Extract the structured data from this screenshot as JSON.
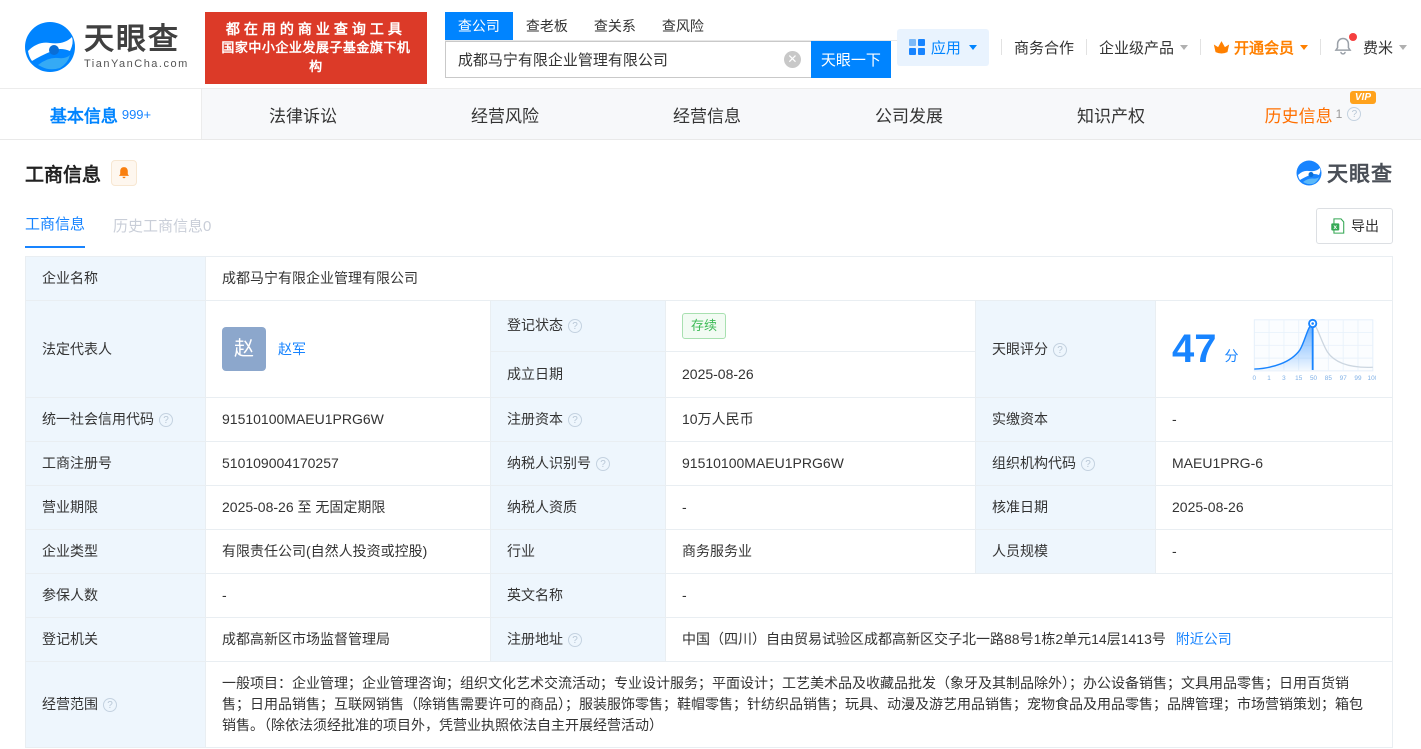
{
  "header": {
    "logo": {
      "title": "天眼查",
      "subtitle": "TianYanCha.com"
    },
    "slogan": {
      "line1": "都在用的商业查询工具",
      "line2": "国家中小企业发展子基金旗下机构"
    },
    "search": {
      "tabs": [
        {
          "label": "查公司"
        },
        {
          "label": "查老板"
        },
        {
          "label": "查关系"
        },
        {
          "label": "查风险"
        }
      ],
      "value": "成都马宁有限企业管理有限公司",
      "button": "天眼一下"
    },
    "menu": {
      "apps": "应用",
      "cooperation": "商务合作",
      "enterprise": "企业级产品",
      "vip": "开通会员",
      "username": "费米"
    }
  },
  "icons": {
    "clear": "circle-x",
    "apps": "grid",
    "vip": "crown",
    "notification": "bell",
    "monitor": "bell",
    "export": "excel",
    "help": "question-circle"
  },
  "nav_tabs": [
    {
      "label": "基本信息",
      "count": "999+"
    },
    {
      "label": "法律诉讼"
    },
    {
      "label": "经营风险"
    },
    {
      "label": "经营信息"
    },
    {
      "label": "公司发展"
    },
    {
      "label": "知识产权"
    },
    {
      "label": "历史信息",
      "badge": "VIP",
      "count": "1"
    }
  ],
  "section": {
    "title": "工商信息",
    "watermark": "天眼查",
    "subtabs": {
      "current": "工商信息",
      "history": "历史工商信息0"
    },
    "export_label": "导出"
  },
  "table": {
    "company_name": {
      "label": "企业名称",
      "value": "成都马宁有限企业管理有限公司"
    },
    "legal_rep": {
      "label": "法定代表人",
      "avatar": "赵",
      "name": "赵军"
    },
    "reg_status": {
      "label": "登记状态",
      "value": "存续"
    },
    "establish_date": {
      "label": "成立日期",
      "value": "2025-08-26"
    },
    "score": {
      "label": "天眼评分",
      "value": "47",
      "unit": "分",
      "axis_ticks": [
        "0",
        "1",
        "3",
        "15",
        "50",
        "85",
        "97",
        "99",
        "100"
      ]
    },
    "credit_code": {
      "label": "统一社会信用代码",
      "value": "91510100MAEU1PRG6W"
    },
    "reg_capital": {
      "label": "注册资本",
      "value": "10万人民币"
    },
    "paid_capital": {
      "label": "实缴资本",
      "value": "-"
    },
    "reg_number": {
      "label": "工商注册号",
      "value": "510109004170257"
    },
    "taxpayer_id": {
      "label": "纳税人识别号",
      "value": "91510100MAEU1PRG6W"
    },
    "org_code": {
      "label": "组织机构代码",
      "value": "MAEU1PRG-6"
    },
    "business_term": {
      "label": "营业期限",
      "value": "2025-08-26 至 无固定期限"
    },
    "taxpayer_quality": {
      "label": "纳税人资质",
      "value": "-"
    },
    "approval_date": {
      "label": "核准日期",
      "value": "2025-08-26"
    },
    "company_type": {
      "label": "企业类型",
      "value": "有限责任公司(自然人投资或控股)"
    },
    "industry": {
      "label": "行业",
      "value": "商务服务业"
    },
    "staff_size": {
      "label": "人员规模",
      "value": "-"
    },
    "insured_count": {
      "label": "参保人数",
      "value": "-"
    },
    "english_name": {
      "label": "英文名称",
      "value": "-"
    },
    "reg_authority": {
      "label": "登记机关",
      "value": "成都高新区市场监督管理局"
    },
    "reg_address": {
      "label": "注册地址",
      "value": "中国（四川）自由贸易试验区成都高新区交子北一路88号1栋2单元14层1413号",
      "link": "附近公司"
    },
    "business_scope": {
      "label": "经营范围",
      "value": "一般项目：企业管理；企业管理咨询；组织文化艺术交流活动；专业设计服务；平面设计；工艺美术品及收藏品批发（象牙及其制品除外）；办公设备销售；文具用品零售；日用百货销售；日用品销售；互联网销售（除销售需要许可的商品）；服装服饰零售；鞋帽零售；针纺织品销售；玩具、动漫及游艺用品销售；宠物食品及用品零售；品牌管理；市场营销策划；箱包销售。（除依法须经批准的项目外，凭营业执照依法自主开展经营活动）"
    }
  },
  "colors": {
    "primary": "#0084ff",
    "link": "#1884ff",
    "slogan_bg": "#dc3a28",
    "vip_orange": "#ff8000",
    "status_green": "#3dbb56",
    "label_bg": "#eef6fd"
  }
}
